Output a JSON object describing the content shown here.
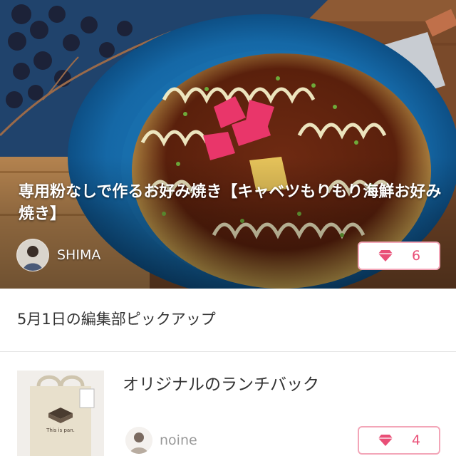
{
  "hero": {
    "title": "専用粉なしで作るお好み焼き【キャベツもりもり海鮮お好み焼き】",
    "author_name": "SHIMA",
    "like_count": "6"
  },
  "section": {
    "title": "5月1日の編集部ピックアップ"
  },
  "item": {
    "title": "オリジナルのランチバック",
    "author_name": "noine",
    "like_count": "4",
    "bag_text": "This is pan."
  },
  "colors": {
    "accent_pink": "#e94f77",
    "like_border": "#f3a6b8",
    "plate_blue": "#1a6fae"
  },
  "icons": {
    "like": "diamond-icon"
  }
}
